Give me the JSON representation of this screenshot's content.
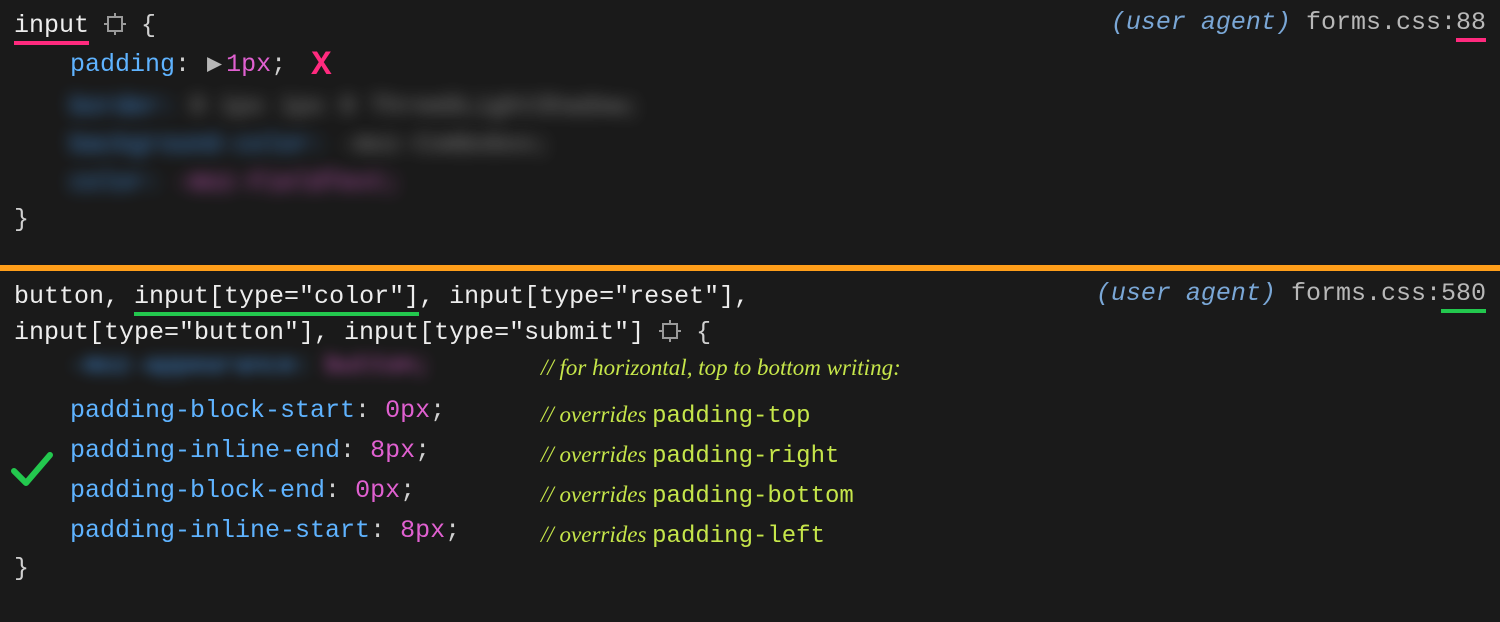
{
  "panel1": {
    "selector": {
      "text": "input"
    },
    "source": {
      "ua": "(user agent)",
      "file": "forms.css",
      "line": "88"
    },
    "decl": {
      "prop": "padding",
      "val": "1px"
    }
  },
  "panel2": {
    "source": {
      "ua": "(user agent)",
      "file": "forms.css",
      "line": "580"
    },
    "selector_parts": {
      "p1": "button, ",
      "p2_underlined": "input[type=\"color\"]",
      "p3": ", input[type=\"reset\"],",
      "line2": "input[type=\"button\"], input[type=\"submit\"] ",
      "brace": "{"
    },
    "comment_heading": "// for horizontal, top to bottom writing:",
    "decls": [
      {
        "prop": "padding-block-start",
        "val": "0px",
        "comment_pre": "// overrides ",
        "comment_mono": "padding-top"
      },
      {
        "prop": "padding-inline-end",
        "val": "8px",
        "comment_pre": "// overrides ",
        "comment_mono": "padding-right"
      },
      {
        "prop": "padding-block-end",
        "val": "0px",
        "comment_pre": "// overrides ",
        "comment_mono": "padding-bottom"
      },
      {
        "prop": "padding-inline-start",
        "val": "8px",
        "comment_pre": "// overrides ",
        "comment_mono": "padding-left"
      }
    ]
  },
  "marks": {
    "x": "X"
  }
}
